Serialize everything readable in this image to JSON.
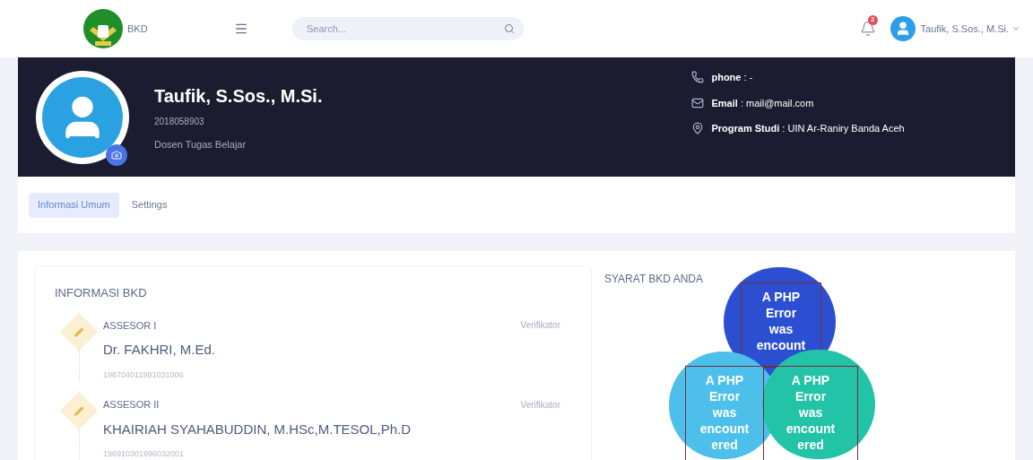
{
  "header": {
    "brand": "BKD",
    "search": {
      "placeholder": "Search..."
    },
    "notifications": "2",
    "user": "Taufik, S.Sos., M.Si."
  },
  "profile": {
    "name": "Taufik, S.Sos., M.Si.",
    "id": "2018058903",
    "role": "Dosen Tugas Belajar",
    "separator": ":",
    "contacts": [
      {
        "kind": "phone",
        "label": "phone",
        "value": "-"
      },
      {
        "kind": "email",
        "label": "Email",
        "value": "mail@mail.com"
      },
      {
        "kind": "location",
        "label": "Program Studi",
        "value": "UIN Ar-Raniry Banda Aceh"
      }
    ]
  },
  "tabs": [
    {
      "label": "Informasi Umum",
      "selected": true
    },
    {
      "label": "Settings",
      "selected": false
    }
  ],
  "info": {
    "title": "INFORMASI BKD",
    "items": [
      {
        "role": "ASSESOR I",
        "name": "Dr. FAKHRI, M.Ed.",
        "nip": "196704011991031006",
        "tag": "Verifikator"
      },
      {
        "role": "ASSESOR II",
        "name": "KHAIRIAH SYAHABUDDIN, M.HSc,M.TESOL,Ph.D",
        "nip": "196910301996032001",
        "tag": "Verifikator"
      }
    ]
  },
  "requirements": {
    "title": "SYARAT BKD ANDA",
    "blobs": [
      {
        "color": "#2c4fd1",
        "lines": [
          "A PHP",
          "Error",
          "was",
          "encount"
        ]
      },
      {
        "color": "#4cc0ea",
        "lines": [
          "A PHP",
          "Error",
          "was",
          "encount",
          "ered"
        ]
      },
      {
        "color": "#22c3a6",
        "lines": [
          "A PHP",
          "Error",
          "was",
          "encount",
          "ered"
        ]
      }
    ]
  }
}
